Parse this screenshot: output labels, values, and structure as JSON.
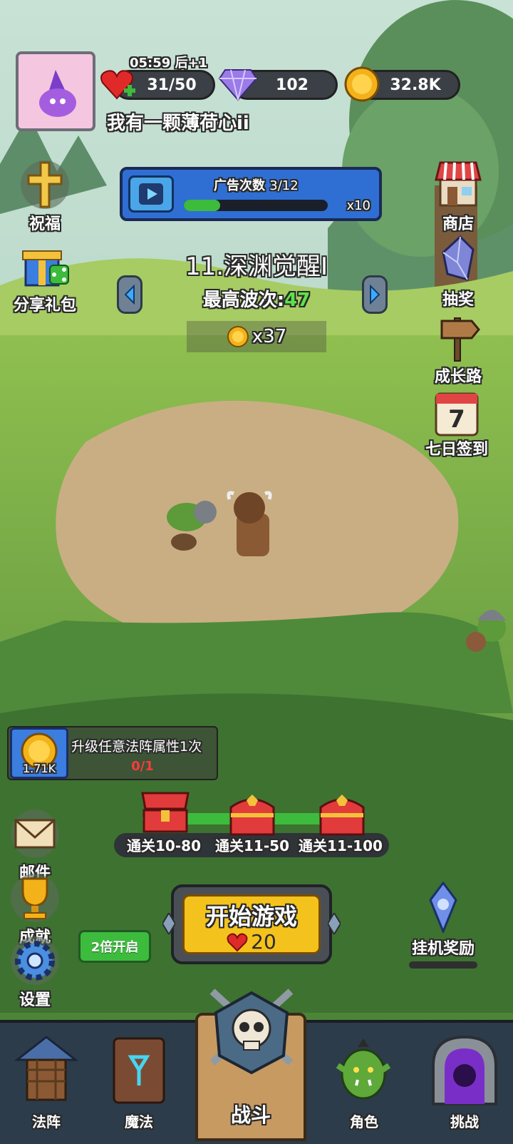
{
  "player": {
    "name": "我有一颗薄荷心ii",
    "timer": "05:59",
    "timer_suffix": "后+1",
    "hearts": "31/50",
    "gems": "102",
    "coins": "32.8K"
  },
  "ad_panel": {
    "label": "广告次数",
    "count": "3/12",
    "multiplier": "x10",
    "progress": 0.25
  },
  "stage": {
    "title": "11.深渊觉醒I",
    "best_wave_label": "最高波次:",
    "best_wave_value": "47",
    "reward": "x37"
  },
  "left_menu": [
    {
      "label": "祝福",
      "icon": "cross-icon"
    },
    {
      "label": "分享礼包",
      "icon": "gift-share-icon"
    }
  ],
  "right_menu": [
    {
      "label": "商店",
      "icon": "shop-icon"
    },
    {
      "label": "抽奖",
      "icon": "crystal-icon"
    },
    {
      "label": "成长路",
      "icon": "signpost-icon"
    },
    {
      "label": "七日签到",
      "icon": "calendar-icon",
      "badge": "7"
    }
  ],
  "quest": {
    "text": "升级任意法阵属性1次",
    "progress": "0/1",
    "reward": "1.71K"
  },
  "chests": [
    {
      "label": "通关10-80"
    },
    {
      "label": "通关11-50"
    },
    {
      "label": "通关11-100"
    }
  ],
  "bottom_left": [
    {
      "label": "邮件",
      "icon": "mail-icon"
    },
    {
      "label": "成就",
      "icon": "trophy-icon"
    },
    {
      "label": "设置",
      "icon": "gear-icon"
    }
  ],
  "double_button": "2倍开启",
  "start_button": {
    "label": "开始游戏",
    "cost": "20"
  },
  "idle_reward": "挂机奖励",
  "tabs": [
    {
      "label": "法阵",
      "icon": "tower-icon"
    },
    {
      "label": "魔法",
      "icon": "spellbook-icon"
    },
    {
      "label": "战斗",
      "icon": "skull-swords-icon"
    },
    {
      "label": "角色",
      "icon": "orc-icon"
    },
    {
      "label": "挑战",
      "icon": "portal-icon"
    }
  ],
  "colors": {
    "accent_green": "#3dbb3d",
    "start_yellow": "#f4c21c",
    "ad_panel_blue": "#2f6fd4",
    "wave_green": "#5fe04a"
  }
}
